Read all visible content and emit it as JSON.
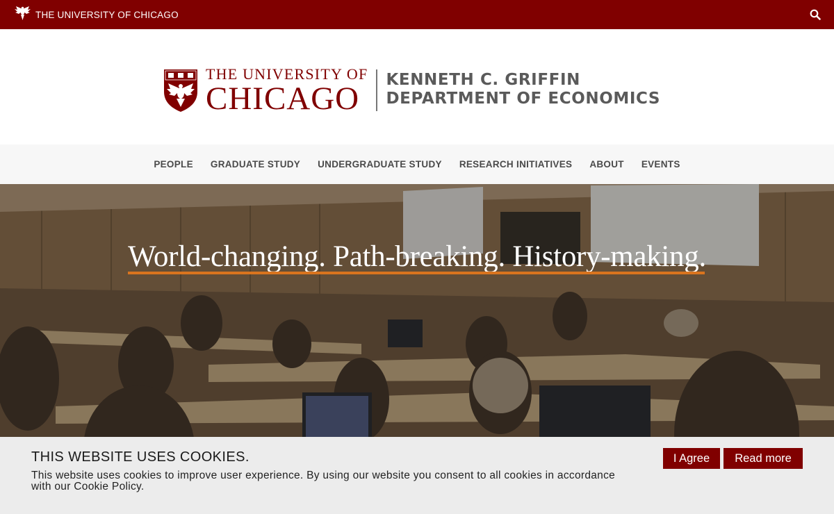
{
  "topbar": {
    "brand": "THE UNIVERSITY OF CHICAGO",
    "brand_icon": "phoenix-icon",
    "search_icon": "search-icon",
    "background": "#800000"
  },
  "logo": {
    "the_university_of": "THE UNIVERSITY OF",
    "chicago": "CHICAGO",
    "dept_line1": "KENNETH C. GRIFFIN",
    "dept_line2": "DEPARTMENT OF ECONOMICS",
    "crest_icon": "university-crest-icon",
    "color": "#800000"
  },
  "nav": {
    "items": [
      {
        "label": "PEOPLE"
      },
      {
        "label": "GRADUATE STUDY"
      },
      {
        "label": "UNDERGRADUATE STUDY"
      },
      {
        "label": "RESEARCH INITIATIVES"
      },
      {
        "label": "ABOUT"
      },
      {
        "label": "EVENTS"
      }
    ]
  },
  "hero": {
    "tagline": "World-changing. Path-breaking. History-making.",
    "underline_color": "#d9741e"
  },
  "cookie": {
    "title": "THIS WEBSITE USES COOKIES.",
    "text": "This website uses cookies to improve user experience. By using our website you consent to all cookies in accordance with our Cookie Policy.",
    "agree_label": "I Agree",
    "read_more_label": "Read more"
  }
}
